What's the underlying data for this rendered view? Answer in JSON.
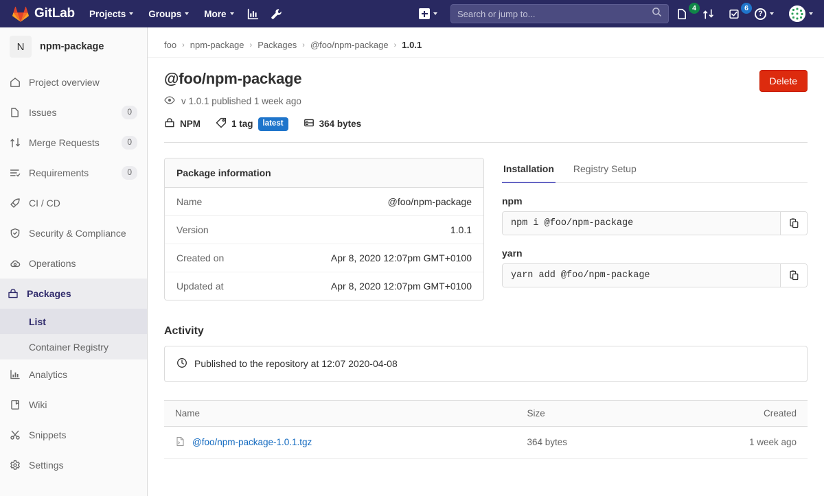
{
  "navbar": {
    "brand": "GitLab",
    "brand_icon": "gitlab-tanuki-logo",
    "items": [
      {
        "label": "Projects",
        "icon": "chevron-down-icon"
      },
      {
        "label": "Groups",
        "icon": "chevron-down-icon"
      },
      {
        "label": "More",
        "icon": "chevron-down-icon"
      }
    ],
    "icon_buttons": [
      {
        "name": "analytics-chart-icon"
      },
      {
        "name": "wrench-admin-icon"
      }
    ],
    "new_dropdown": {
      "icon": "plus-square-icon",
      "caret": "chevron-down-icon"
    },
    "search": {
      "placeholder": "Search or jump to...",
      "value": "",
      "icon": "search-icon"
    },
    "status": [
      {
        "name": "issues-icon",
        "count": "4",
        "color": "#108548"
      },
      {
        "name": "merge-requests-icon",
        "count": ""
      },
      {
        "name": "todos-icon",
        "count": "6",
        "color": "#1f75cb"
      }
    ],
    "help": {
      "label": "?",
      "icon": "help-circle-icon"
    },
    "avatar": {
      "icon": "user-avatar-identicon"
    }
  },
  "sidebar": {
    "project": {
      "initial": "N",
      "name": "npm-package"
    },
    "items": [
      {
        "label": "Project overview",
        "icon": "home-icon",
        "count": ""
      },
      {
        "label": "Issues",
        "icon": "issues-icon",
        "count": "0"
      },
      {
        "label": "Merge Requests",
        "icon": "merge-request-icon",
        "count": "0"
      },
      {
        "label": "Requirements",
        "icon": "requirements-icon",
        "count": "0"
      },
      {
        "label": "CI / CD",
        "icon": "rocket-icon",
        "count": ""
      },
      {
        "label": "Security & Compliance",
        "icon": "shield-icon",
        "count": ""
      },
      {
        "label": "Operations",
        "icon": "cloud-gear-icon",
        "count": ""
      }
    ],
    "packages_section": {
      "label": "Packages",
      "icon": "package-icon",
      "sub_items": [
        {
          "label": "List",
          "active": true
        },
        {
          "label": "Container Registry",
          "active": false
        }
      ]
    },
    "items_after": [
      {
        "label": "Analytics",
        "icon": "analytics-chart-icon",
        "count": ""
      },
      {
        "label": "Wiki",
        "icon": "book-icon",
        "count": ""
      },
      {
        "label": "Snippets",
        "icon": "scissors-icon",
        "count": ""
      },
      {
        "label": "Settings",
        "icon": "gear-icon",
        "count": ""
      }
    ]
  },
  "breadcrumb": {
    "items": [
      "foo",
      "npm-package",
      "Packages",
      "@foo/npm-package"
    ],
    "current": "1.0.1",
    "separator": "›"
  },
  "package": {
    "title": "@foo/npm-package",
    "published_line": "v 1.0.1 published 1 week ago",
    "published_icon": "eye-icon",
    "type": "NPM",
    "type_icon": "package-icon",
    "tag_count": "1 tag",
    "tag_icon": "tag-icon",
    "tag_badge": "latest",
    "size": "364 bytes",
    "size_icon": "storage-icon",
    "delete_label": "Delete"
  },
  "package_information": {
    "title": "Package information",
    "rows": [
      {
        "key": "Name",
        "value": "@foo/npm-package"
      },
      {
        "key": "Version",
        "value": "1.0.1"
      },
      {
        "key": "Created on",
        "value": "Apr 8, 2020 12:07pm GMT+0100"
      },
      {
        "key": "Updated at",
        "value": "Apr 8, 2020 12:07pm GMT+0100"
      }
    ]
  },
  "installation": {
    "tabs": [
      {
        "label": "Installation",
        "active": true
      },
      {
        "label": "Registry Setup",
        "active": false
      }
    ],
    "blocks": [
      {
        "label": "npm",
        "command": "npm i @foo/npm-package",
        "copy_icon": "clipboard-copy-icon"
      },
      {
        "label": "yarn",
        "command": "yarn add @foo/npm-package",
        "copy_icon": "clipboard-copy-icon"
      }
    ]
  },
  "activity": {
    "title": "Activity",
    "icon": "clock-icon",
    "entry": "Published to the repository at 12:07 2020-04-08"
  },
  "files": {
    "columns": [
      "Name",
      "Size",
      "Created"
    ],
    "rows": [
      {
        "name": "@foo/npm-package-1.0.1.tgz",
        "icon": "file-archive-icon",
        "size": "364 bytes",
        "created": "1 week ago"
      }
    ]
  },
  "colors": {
    "navbar_bg": "#292961",
    "accent_purple": "#6666c4",
    "danger_red": "#dd2b0e",
    "link_blue": "#1068bf",
    "badge_blue": "#1f75cb",
    "badge_green": "#108548"
  }
}
